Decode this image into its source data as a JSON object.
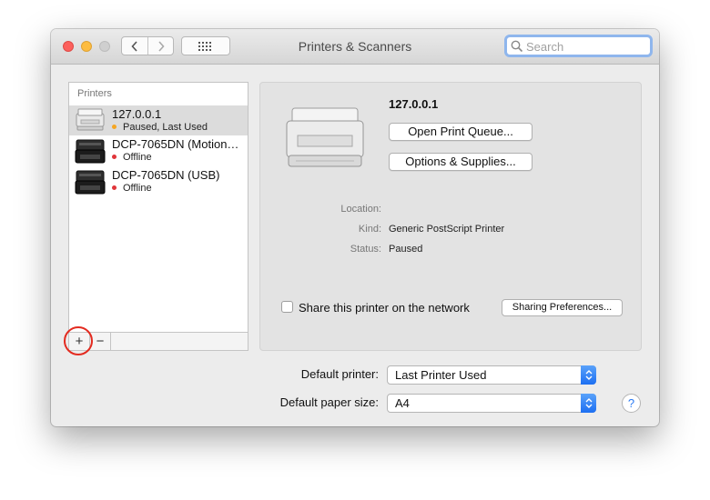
{
  "window": {
    "title": "Printers & Scanners",
    "search_placeholder": "Search"
  },
  "icons": {
    "back": "chevron-left-icon",
    "forward": "chevron-right-icon",
    "grid": "show-all-grid-icon",
    "search": "magnifier-icon",
    "help": "question-mark-icon"
  },
  "printers": {
    "header": "Printers",
    "items": [
      {
        "name": "127.0.0.1",
        "status": "Paused, Last Used",
        "status_color": "#f5a623",
        "selected": true
      },
      {
        "name": "DCP-7065DN (Motion…",
        "status": "Offline",
        "status_color": "#e0353a",
        "selected": false
      },
      {
        "name": "DCP-7065DN (USB)",
        "status": "Offline",
        "status_color": "#e0353a",
        "selected": false
      }
    ],
    "add_label": "+",
    "remove_label": "−",
    "highlight_color": "#e32b20"
  },
  "detail": {
    "name": "127.0.0.1",
    "open_queue_label": "Open Print Queue...",
    "options_label": "Options & Supplies...",
    "location_label": "Location:",
    "location_value": "",
    "kind_label": "Kind:",
    "kind_value": "Generic PostScript Printer",
    "status_label": "Status:",
    "status_value": "Paused",
    "share_label": "Share this printer on the network",
    "share_checked": false,
    "sharing_prefs_label": "Sharing Preferences..."
  },
  "defaults": {
    "printer_label": "Default printer:",
    "printer_value": "Last Printer Used",
    "paper_label": "Default paper size:",
    "paper_value": "A4",
    "help_label": "?"
  }
}
